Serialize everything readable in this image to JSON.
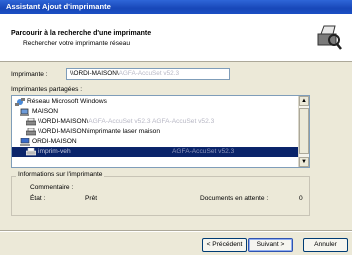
{
  "window": {
    "title": "Assistant Ajout d'imprimante"
  },
  "header": {
    "title": "Parcourir à la recherche d'une imprimante",
    "subtitle": "Rechercher votre imprimante réseau",
    "icon": "printer-search-icon"
  },
  "printer_field": {
    "label": "Imprimante :",
    "value_prefix": "\\\\ORDI-MAISON\\",
    "value_suffix": "AGFA-AccuSet v52.3"
  },
  "shared": {
    "label": "Imprimantes partagées :",
    "items": [
      {
        "label": "Réseau Microsoft Windows",
        "icon": "network-icon",
        "indent": 0,
        "selected": false
      },
      {
        "label": "MAISON",
        "icon": "workgroup-icon",
        "indent": 1,
        "selected": false
      },
      {
        "label": "\\\\ORDI-MAISON\\",
        "label_suffix": "AGFA-AccuSet v52.3 AGFA-AccuSet v52.3",
        "icon": "printer-icon",
        "indent": 2,
        "selected": false
      },
      {
        "label": "\\\\ORDI-MAISON\\imprimante laser maison",
        "label_suffix": "",
        "icon": "printer-icon",
        "indent": 2,
        "selected": false
      },
      {
        "label": "ORDI-MAISON",
        "icon": "computer-icon",
        "indent": 1,
        "selected": false
      },
      {
        "label": "imprim-veh",
        "label_suffix": "AGFA-AccuSet v52.3",
        "icon": "printer-icon",
        "indent": 2,
        "selected": true
      }
    ]
  },
  "info": {
    "title": "Informations sur l'imprimante",
    "comment_label": "Commentaire :",
    "state_label": "État :",
    "state_value": "Prêt",
    "docs_label": "Documents en attente :",
    "docs_value": "0"
  },
  "buttons": {
    "back": "< Précédent",
    "next": "Suivant >",
    "cancel": "Annuler"
  }
}
